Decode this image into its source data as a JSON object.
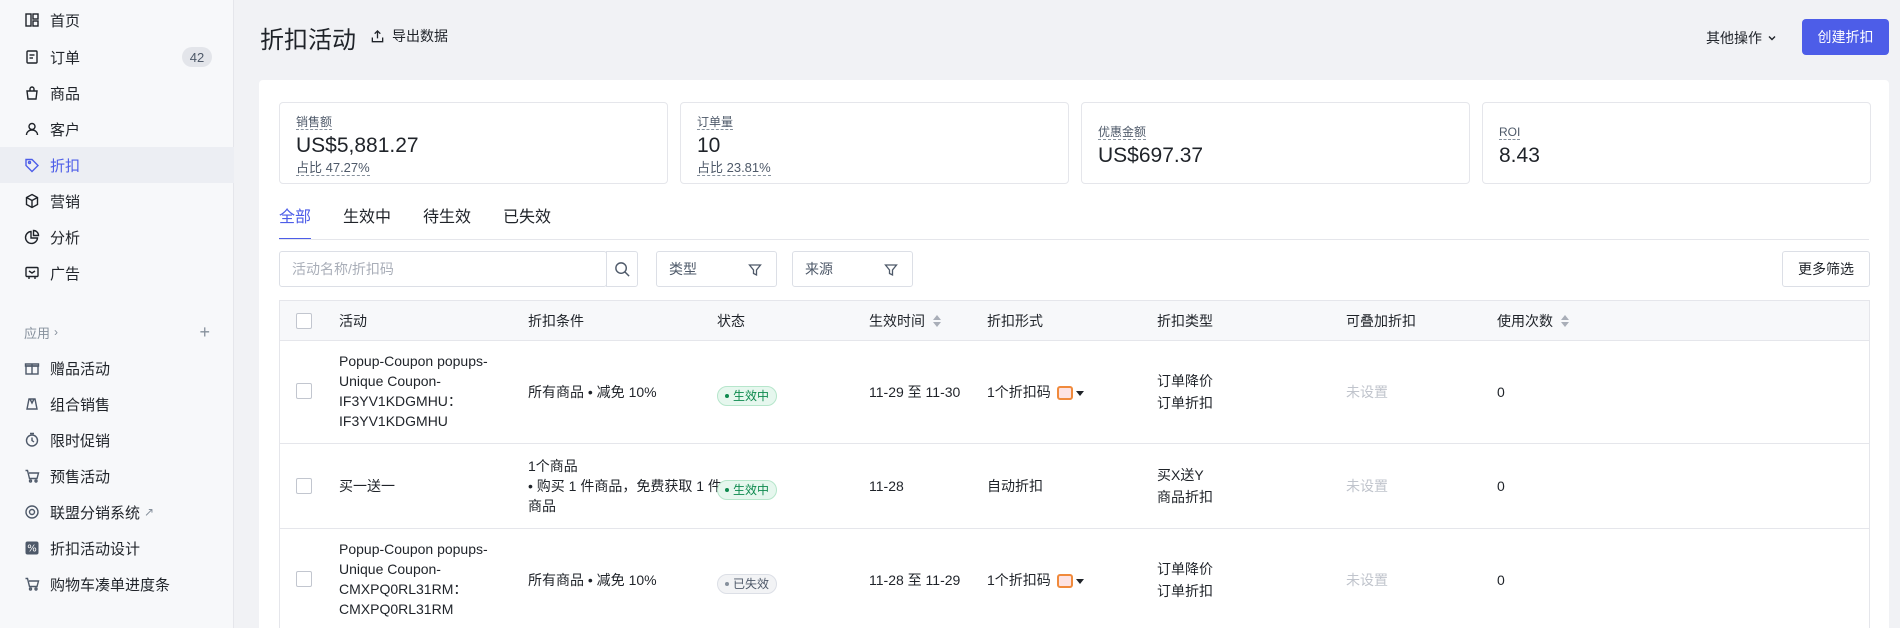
{
  "sidebar": {
    "items": [
      {
        "label": "首页",
        "icon": "home-icon"
      },
      {
        "label": "订单",
        "icon": "orders-icon",
        "badge": "42"
      },
      {
        "label": "商品",
        "icon": "products-icon"
      },
      {
        "label": "客户",
        "icon": "customers-icon"
      },
      {
        "label": "折扣",
        "icon": "discount-tag-icon",
        "active": true
      },
      {
        "label": "营销",
        "icon": "marketing-icon"
      },
      {
        "label": "分析",
        "icon": "analytics-icon"
      },
      {
        "label": "广告",
        "icon": "ads-icon"
      }
    ],
    "apps_label": "应用",
    "apps": [
      {
        "label": "赠品活动",
        "icon": "gift-icon"
      },
      {
        "label": "组合销售",
        "icon": "bundle-icon"
      },
      {
        "label": "限时促销",
        "icon": "flash-sale-icon"
      },
      {
        "label": "预售活动",
        "icon": "presale-icon"
      },
      {
        "label": "联盟分销系统",
        "icon": "affiliate-icon"
      },
      {
        "label": "折扣活动设计",
        "icon": "percent-icon"
      },
      {
        "label": "购物车凑单进度条",
        "icon": "cart-icon"
      }
    ]
  },
  "header": {
    "title": "折扣活动",
    "export_label": "导出数据",
    "more_ops_label": "其他操作",
    "create_label": "创建折扣"
  },
  "stats": [
    {
      "label": "销售额",
      "value": "US$5,881.27",
      "sub": "占比 47.27%"
    },
    {
      "label": "订单量",
      "value": "10",
      "sub": "占比 23.81%"
    },
    {
      "label": "优惠金额",
      "value": "US$697.37",
      "sub": ""
    },
    {
      "label": "ROI",
      "value": "8.43",
      "sub": ""
    }
  ],
  "tabs": [
    "全部",
    "生效中",
    "待生效",
    "已失效"
  ],
  "filters": {
    "search_placeholder": "活动名称/折扣码",
    "type_label": "类型",
    "source_label": "来源",
    "more_label": "更多筛选"
  },
  "table": {
    "columns": [
      "活动",
      "折扣条件",
      "状态",
      "生效时间",
      "折扣形式",
      "折扣类型",
      "可叠加折扣",
      "使用次数"
    ],
    "rows": [
      {
        "activity": [
          "Popup-Coupon popups-",
          "Unique Coupon-",
          "IF3YV1KDGMHU：",
          "IF3YV1KDGMHU"
        ],
        "condition": [
          "所有商品 • 减免 10%"
        ],
        "status": "生效中",
        "status_kind": "active",
        "time": "11-29 至 11-30",
        "form": "1个折扣码",
        "has_code_icon": true,
        "type": [
          "订单降价",
          "订单折扣"
        ],
        "stackable": "未设置",
        "uses": "0"
      },
      {
        "activity": [
          "买一送一"
        ],
        "condition": [
          "1个商品",
          "• 购买 1 件商品，免费获取 1 件",
          "商品"
        ],
        "status": "生效中",
        "status_kind": "active",
        "time": "11-28",
        "form": "自动折扣",
        "has_code_icon": false,
        "type": [
          "买X送Y",
          "商品折扣"
        ],
        "stackable": "未设置",
        "uses": "0"
      },
      {
        "activity": [
          "Popup-Coupon popups-",
          "Unique Coupon-",
          "CMXPQ0RL31RM：",
          "CMXPQ0RL31RM"
        ],
        "condition": [
          "所有商品 • 减免 10%"
        ],
        "status": "已失效",
        "status_kind": "expired",
        "time": "11-28 至 11-29",
        "form": "1个折扣码",
        "has_code_icon": true,
        "type": [
          "订单降价",
          "订单折扣"
        ],
        "stackable": "未设置",
        "uses": "0"
      }
    ]
  }
}
